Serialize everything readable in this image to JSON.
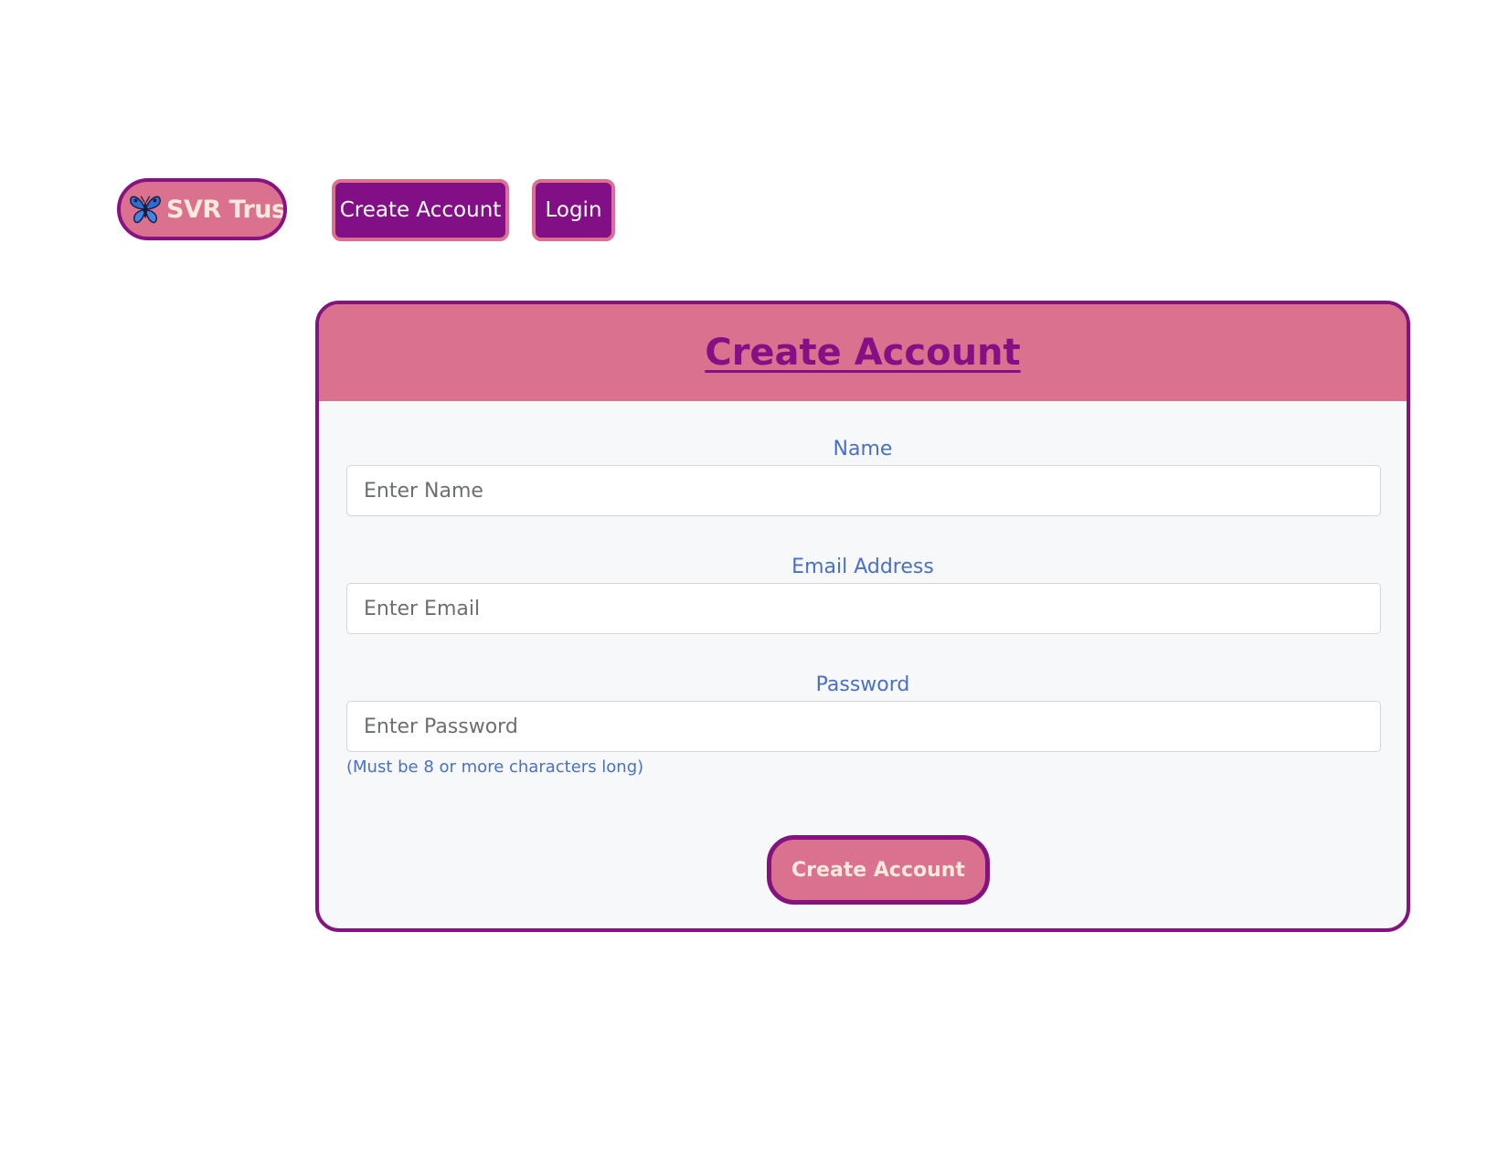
{
  "nav": {
    "brand_label": "SVR Trust",
    "brand_icon": "butterfly-icon",
    "create_account_label": "Create Account",
    "login_label": "Login"
  },
  "form": {
    "title": "Create Account",
    "name": {
      "label": "Name",
      "placeholder": "Enter Name",
      "value": ""
    },
    "email": {
      "label": "Email Address",
      "placeholder": "Enter Email",
      "value": ""
    },
    "password": {
      "label": "Password",
      "placeholder": "Enter Password",
      "value": "",
      "hint": "(Must be 8 or more characters long)"
    },
    "submit_label": "Create Account"
  },
  "colors": {
    "brand_pink": "#d9718f",
    "brand_purple": "#84127f",
    "label_blue": "#4a6fc9",
    "card_background": "#f7f8fa"
  }
}
